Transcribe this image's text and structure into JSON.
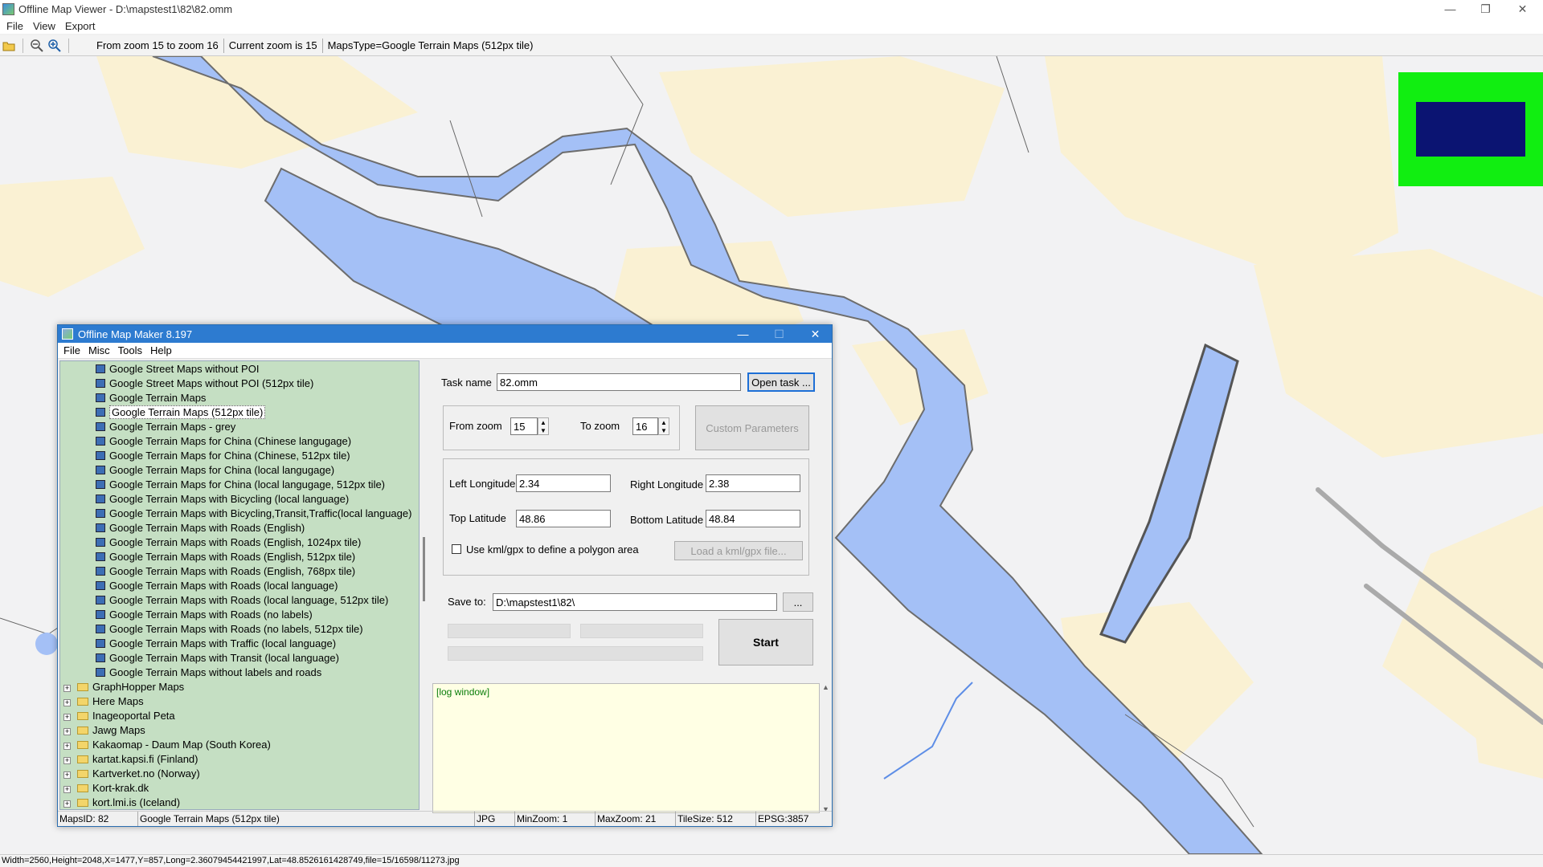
{
  "window": {
    "title": "Offline Map Viewer - D:\\mapstest1\\82\\82.omm",
    "controls": {
      "minimize": "—",
      "restore": "❐",
      "close": "✕"
    }
  },
  "menu": [
    "File",
    "View",
    "Export"
  ],
  "toolbar": {
    "icons": [
      "open-folder-icon",
      "zoom-out-icon",
      "zoom-in-icon"
    ],
    "zoom_range": "From zoom 15 to zoom 16",
    "current_zoom": "Current zoom is 15",
    "maps_type": "MapsType=Google Terrain Maps (512px tile)"
  },
  "colors": {
    "river": "#a4c0f6",
    "land": "#f2f2f3",
    "urban": "#faf1d3",
    "minimap_bg": "#11ee11",
    "minimap_view": "#0b1472",
    "tree_bg": "#c5dfc3",
    "log_bg": "#ffffe4"
  },
  "status": "Width=2560,Height=2048,X=1477,Y=857,Long=2.36079454421997,Lat=48.8526161428749,file=15/16598/11273.jpg",
  "dialog": {
    "title": "Offline Map Maker 8.197",
    "menu": [
      "File",
      "Misc",
      "Tools",
      "Help"
    ],
    "tree_maps": [
      "Google Street Maps without POI",
      "Google Street Maps without POI (512px tile)",
      "Google Terrain Maps",
      "Google Terrain Maps (512px tile)",
      "Google Terrain Maps - grey",
      "Google Terrain Maps for China (Chinese langugage)",
      "Google Terrain Maps for China (Chinese, 512px tile)",
      "Google Terrain Maps for China (local langugage)",
      "Google Terrain Maps for China (local langugage, 512px tile)",
      "Google Terrain Maps with Bicycling (local language)",
      "Google Terrain Maps with Bicycling,Transit,Traffic(local language)",
      "Google Terrain Maps with Roads (English)",
      "Google Terrain Maps with Roads (English, 1024px tile)",
      "Google Terrain Maps with Roads (English, 512px tile)",
      "Google Terrain Maps with Roads (English, 768px tile)",
      "Google Terrain Maps with Roads (local language)",
      "Google Terrain Maps with Roads (local language, 512px tile)",
      "Google Terrain Maps with Roads (no labels)",
      "Google Terrain Maps with Roads (no labels, 512px tile)",
      "Google Terrain Maps with Traffic (local language)",
      "Google Terrain Maps with Transit (local language)",
      "Google Terrain Maps without labels and roads"
    ],
    "tree_selected_index": 3,
    "tree_folders": [
      "GraphHopper Maps",
      "Here Maps",
      "Inageoportal Peta",
      "Jawg Maps",
      "Kakaomap - Daum Map (South Korea)",
      "kartat.kapsi.fi (Finland)",
      "Kartverket.no (Norway)",
      "Kort-krak.dk",
      "kort.lmi.is (Iceland)"
    ],
    "task_name_label": "Task name",
    "task_name": "82.omm",
    "open_task": "Open task ...",
    "from_zoom_label": "From zoom",
    "from_zoom": "15",
    "to_zoom_label": "To zoom",
    "to_zoom": "16",
    "custom_params": "Custom Parameters",
    "left_lon_label": "Left Longitude",
    "left_lon": "2.34",
    "right_lon_label": "Right Longitude",
    "right_lon": "2.38",
    "top_lat_label": "Top Latitude",
    "top_lat": "48.86",
    "bottom_lat_label": "Bottom Latitude",
    "bottom_lat": "48.84",
    "kml_label": "Use kml/gpx to define a polygon area",
    "load_kml": "Load a kml/gpx file...",
    "save_to_label": "Save to:",
    "save_to": "D:\\mapstest1\\82\\",
    "browse": "...",
    "start": "Start",
    "log": "[log window]",
    "status": {
      "maps_id": "MapsID: 82",
      "map_name": "Google Terrain Maps (512px tile)",
      "format": "JPG",
      "min_zoom": "MinZoom: 1",
      "max_zoom": "MaxZoom: 21",
      "tile_size": "TileSize: 512",
      "epsg": "EPSG:3857"
    }
  }
}
